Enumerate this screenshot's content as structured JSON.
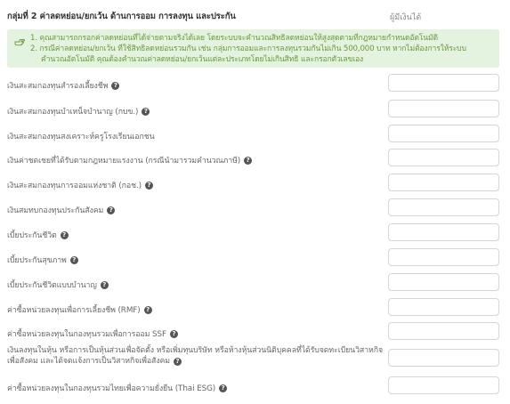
{
  "header": {
    "group_title": "กลุ่มที่ 2 ค่าลดหย่อน/ยกเว้น ด้านการออม การลงทุน และประกัน",
    "amount_header": "ผู้มีเงินได้"
  },
  "notice": {
    "icon": "hand-point-icon",
    "line1": "1. คุณสามารถกรอกค่าลดหย่อนที่ได้จ่ายตามจริงได้เลย โดยระบบจะคำนวณสิทธิลดหย่อนให้สูงสุดตามที่กฎหมายกำหนดอัตโนมัติ",
    "line2": "2. กรณีค่าลดหย่อน/ยกเว้น ที่ใช้สิทธิลดหย่อนรวมกัน เช่น กลุ่มการออมและการลงทุนรวมกันไม่เกิน 500,000 บาท หากไม่ต้องการให้ระบบ",
    "line3": "คำนวณอัตโนมัติ คุณต้องคำนวณค่าลดหย่อน/ยกเว้นแต่ละประเภทโดยไม่เกินสิทธิ และกรอกตัวเลขเอง",
    "color": "#6b9a3c",
    "background": "#e4f2e0"
  },
  "rows": [
    {
      "label": "เงินสะสมกองทุนสำรองเลี้ยงชีพ",
      "value": ""
    },
    {
      "label": "เงินสะสมกองทุนบำเหน็จบำนาญ (กบข.)",
      "value": ""
    },
    {
      "label": "เงินสะสมกองทุนสงเคราะห์ครูโรงเรียนเอกชน",
      "value": ""
    },
    {
      "label": "เงินค่าชดเชยที่ได้รับตามกฎหมายแรงงาน (กรณีนำมารวมคำนวณภาษี)",
      "value": ""
    },
    {
      "label": "เงินสะสมกองทุนการออมแห่งชาติ (กอช.)",
      "value": ""
    },
    {
      "label": "เงินสมทบกองทุนประกันสังคม",
      "value": ""
    },
    {
      "label": "เบี้ยประกันชีวิต",
      "value": ""
    },
    {
      "label": "เบี้ยประกันสุขภาพ",
      "value": ""
    },
    {
      "label": "เบี้ยประกันชีวิตแบบบำนาญ",
      "value": ""
    },
    {
      "label": "ค่าซื้อหน่วยลงทุนเพื่อการเลี้ยงชีพ (RMF)",
      "value": ""
    },
    {
      "label": "ค่าซื้อหน่วยลงทุนในกองทุนรวมเพื่อการออม SSF",
      "value": ""
    },
    {
      "label": "เงินลงทุนในหุ้น หรือการเป็นหุ้นส่วนเพื่อจัดตั้ง หรือเพิ่มทุนบริษัท หรือห้างหุ้นส่วนนิติบุคคลที่ได้รับจดทะเบียนวิสาหกิจ",
      "label2": "เพื่อสังคม และได้จดแจ้งการเป็นวิสาหกิจเพื่อสังคม",
      "value": ""
    },
    {
      "label": "ค่าซื้อหน่วยลงทุนในกองทุนรวมไทยเพื่อความยั่งยืน (Thai ESG)",
      "value": ""
    }
  ],
  "help_glyph": "?"
}
